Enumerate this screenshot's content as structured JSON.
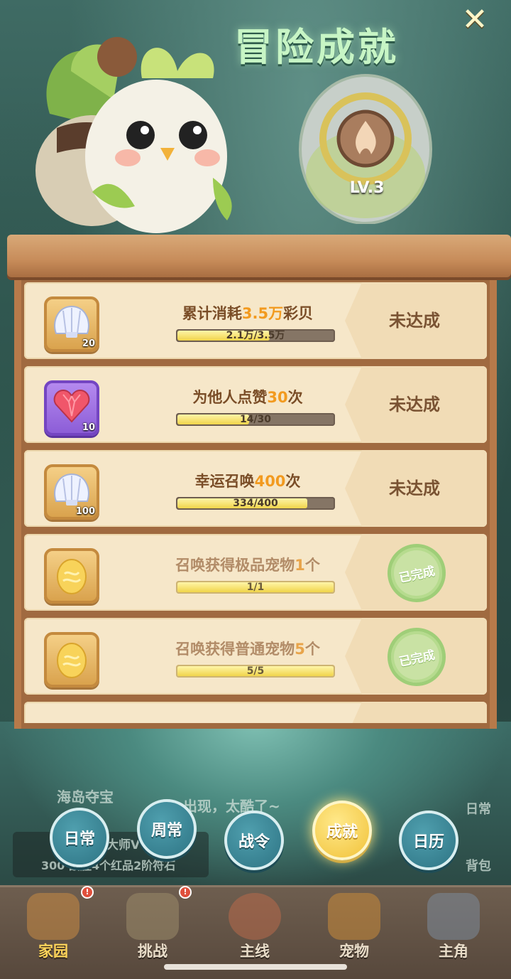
{
  "header": {
    "title": "冒险成就",
    "close_label": "✕",
    "level_label": "LV.3"
  },
  "achievements": [
    {
      "task_prefix": "累计消耗",
      "task_highlight": "3.5万",
      "task_suffix": "彩贝",
      "icon": "shell-icon",
      "icon_count": "20",
      "icon_style": "gold",
      "progress_text": "2.1万/3.5万",
      "progress_fraction": 0.6,
      "status": "未达成",
      "completed": false
    },
    {
      "task_prefix": "为他人点赞",
      "task_highlight": "30",
      "task_suffix": "次",
      "icon": "heart-gem-icon",
      "icon_count": "10",
      "icon_style": "purple",
      "progress_text": "14/30",
      "progress_fraction": 0.467,
      "status": "未达成",
      "completed": false
    },
    {
      "task_prefix": "幸运召唤",
      "task_highlight": "400",
      "task_suffix": "次",
      "icon": "shell-icon",
      "icon_count": "100",
      "icon_style": "gold",
      "progress_text": "334/400",
      "progress_fraction": 0.835,
      "status": "未达成",
      "completed": false
    },
    {
      "task_prefix": "召唤获得极品宠物",
      "task_highlight": "1",
      "task_suffix": "个",
      "icon": "golden-egg-icon",
      "icon_count": "",
      "icon_style": "gold",
      "progress_text": "1/1",
      "progress_fraction": 1.0,
      "status": "已完成",
      "completed": true
    },
    {
      "task_prefix": "召唤获得普通宠物",
      "task_highlight": "5",
      "task_suffix": "个",
      "icon": "golden-egg-icon",
      "icon_count": "",
      "icon_style": "gold",
      "progress_text": "5/5",
      "progress_fraction": 1.0,
      "status": "已完成",
      "completed": true
    }
  ],
  "background_text": {
    "left_event": "海岛夺宝",
    "scroll_message": "出现，太酷了~",
    "right_daily": "日常",
    "right_bag": "背包",
    "panel_line1": "大师V",
    "panel_line2": "300  战胜4个红品2阶符石"
  },
  "tabs": [
    {
      "label": "日常",
      "active": false
    },
    {
      "label": "周常",
      "active": false
    },
    {
      "label": "战令",
      "active": false
    },
    {
      "label": "成就",
      "active": true
    },
    {
      "label": "日历",
      "active": false
    }
  ],
  "bottom_nav": [
    {
      "label": "家园",
      "icon": "home-icon",
      "active": true,
      "badge": true
    },
    {
      "label": "挑战",
      "icon": "challenge-icon",
      "active": false,
      "badge": true
    },
    {
      "label": "主线",
      "icon": "main-quest-icon",
      "active": false,
      "badge": false
    },
    {
      "label": "宠物",
      "icon": "pet-icon",
      "active": false,
      "badge": false
    },
    {
      "label": "主角",
      "icon": "hero-icon",
      "active": false,
      "badge": false
    }
  ],
  "colors": {
    "highlight": "#f29a1f",
    "title": "#c7f5c5",
    "completed_stamp": "#9fce78"
  }
}
